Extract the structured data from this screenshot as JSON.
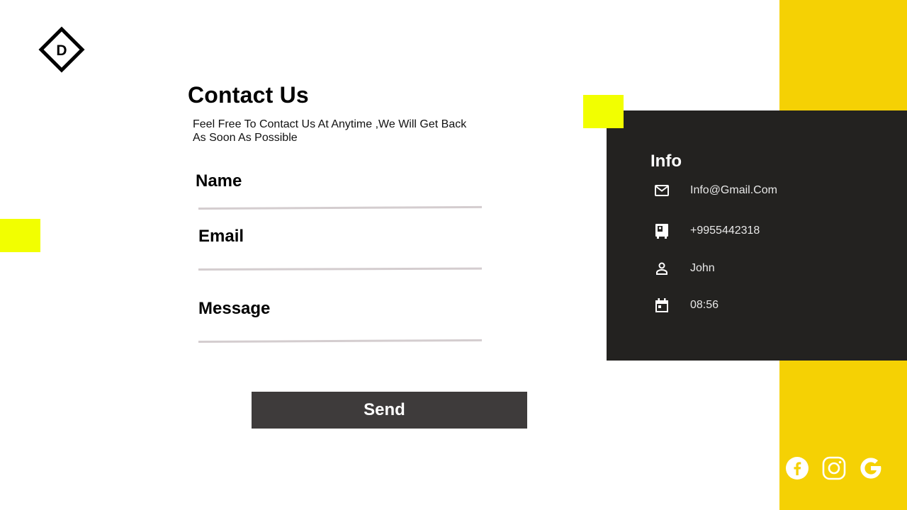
{
  "brand": {
    "logo_letter": "D"
  },
  "contact": {
    "title": "Contact Us",
    "subtitle_line1": "Feel Free To Contact Us At Anytime ,We Will Get Back",
    "subtitle_line2": "As Soon As Possible"
  },
  "form": {
    "name_label": "Name",
    "email_label": "Email",
    "message_label": "Message",
    "name_value": "",
    "email_value": "",
    "message_value": "",
    "send_label": "Send"
  },
  "info": {
    "title": "Info",
    "items": [
      {
        "icon": "mail-icon",
        "text": "Info@Gmail.Com"
      },
      {
        "icon": "phone-icon",
        "text": "+9955442318"
      },
      {
        "icon": "person-icon",
        "text": "John"
      },
      {
        "icon": "calendar-icon",
        "text": "08:56"
      }
    ]
  },
  "socials": [
    {
      "icon": "facebook-icon"
    },
    {
      "icon": "instagram-icon"
    },
    {
      "icon": "google-icon"
    }
  ],
  "colors": {
    "yellow_strip": "#f5d104",
    "accent_yellow": "#f2ff00",
    "card_dark": "#232220",
    "button_dark": "#3e3b3b",
    "field_line": "#d4cdcf"
  }
}
